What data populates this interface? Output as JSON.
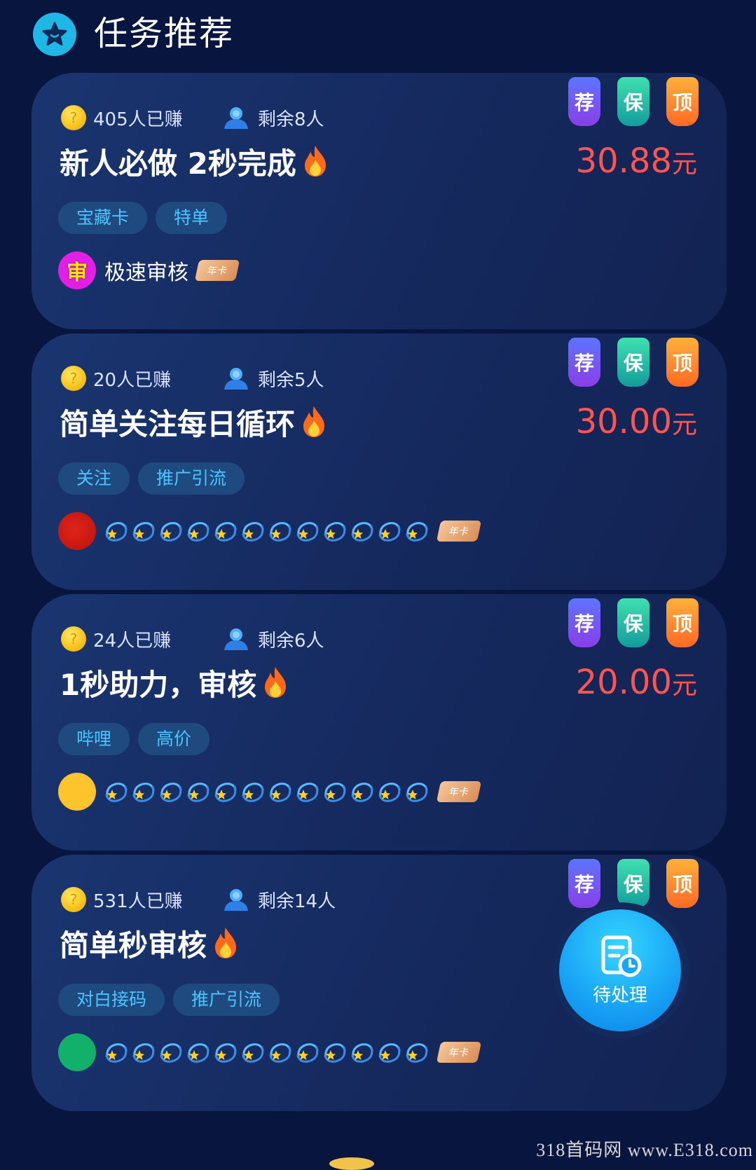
{
  "header": {
    "title": "任务推荐",
    "icon": "star-face-icon"
  },
  "badges": {
    "recommend": "荐",
    "guarantee": "保",
    "top": "顶"
  },
  "year_card_label": "年卡",
  "cards": [
    {
      "earned": "405人已赚",
      "remaining": "剩余8人",
      "title": "新人必做 2秒完成",
      "price": "30.88",
      "unit": "元",
      "tags": [
        "宝藏卡",
        "特单"
      ],
      "avatar_text": "审",
      "user_name": "极速审核"
    },
    {
      "earned": "20人已赚",
      "remaining": "剩余5人",
      "title": "简单关注每日循环",
      "price": "30.00",
      "unit": "元",
      "tags": [
        "关注",
        "推广引流"
      ]
    },
    {
      "earned": "24人已赚",
      "remaining": "剩余6人",
      "title": "1秒助力，审核",
      "price": "20.00",
      "unit": "元",
      "tags": [
        "哔哩",
        "高价"
      ]
    },
    {
      "earned": "531人已赚",
      "remaining": "剩余14人",
      "title": "简单秒审核",
      "price": "",
      "unit": "",
      "tags": [
        "对白接码",
        "推广引流"
      ]
    }
  ],
  "fab": {
    "label": "待处理",
    "icon": "pending-document-clock-icon"
  },
  "watermark": "318首码网 www.E318.com",
  "colors": {
    "background": "#08153f",
    "price": "#ff5550",
    "tag_text": "#4cc4ff",
    "tag_bg": "#1f4a80"
  }
}
